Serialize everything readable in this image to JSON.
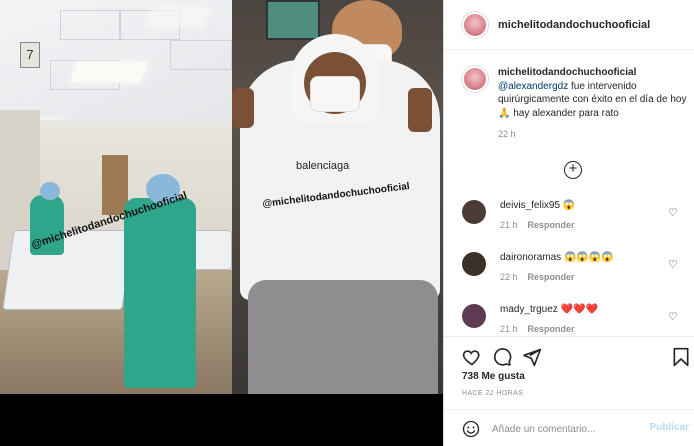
{
  "post": {
    "username": "michelitodandochuchooficial",
    "caption": {
      "username": "michelitodandochuchooficial",
      "mention": "@alexandergdz",
      "text": " fue intervenido quirúrgicamente con éxito en el día de hoy🙏 hay alexander para rato",
      "time": "22 h"
    },
    "image_overlay": {
      "left_text": "@michelitodandochuchooficial",
      "right_text": "@michelitodandochuchooficial",
      "brand": "balenciaga",
      "floor_sign": "7"
    }
  },
  "comments": [
    {
      "username": "deivis_felix95",
      "text": "😱",
      "time": "21 h",
      "reply": "Responder",
      "avatar_color": "#4a3b36"
    },
    {
      "username": "daironoramas",
      "text": "😱😱😱😱",
      "time": "22 h",
      "reply": "Responder",
      "avatar_color": "#3b2f2a"
    },
    {
      "username": "mady_trguez",
      "text": "❤️❤️❤️",
      "time": "21 h",
      "reply": "Responder",
      "avatar_color": "#5e3a55"
    }
  ],
  "actions": {
    "likes": "738 Me gusta",
    "ago": "HACE 22 HORAS",
    "comment_placeholder": "Añade un comentario...",
    "publish": "Publicar"
  },
  "colors": {
    "link": "#00376b",
    "muted": "#8e8e8e",
    "publish_disabled": "#b2dffc"
  }
}
